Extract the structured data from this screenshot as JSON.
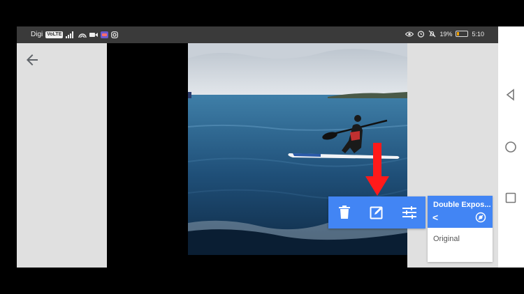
{
  "status_bar": {
    "carrier": "Digi",
    "volte": "VoLTE",
    "battery_percent": "19%",
    "battery_level": 0.19,
    "time": "5:10"
  },
  "editor": {
    "card": {
      "title": "Double Expos...",
      "prev_symbol": "<",
      "original_label": "Original"
    }
  },
  "icons": {
    "back": "arrow-back-icon",
    "menu": "more-vert-icon",
    "delete": "trash-icon",
    "edit": "edit-square-icon",
    "adjust": "tune-sliders-icon",
    "style": "style-palette-icon",
    "arrow": "red-arrow-down-icon"
  },
  "colors": {
    "accent": "#4285f4",
    "arrow": "#ff1a1a",
    "status_bar": "#3a3a3a",
    "panel": "#e0e0e0"
  }
}
